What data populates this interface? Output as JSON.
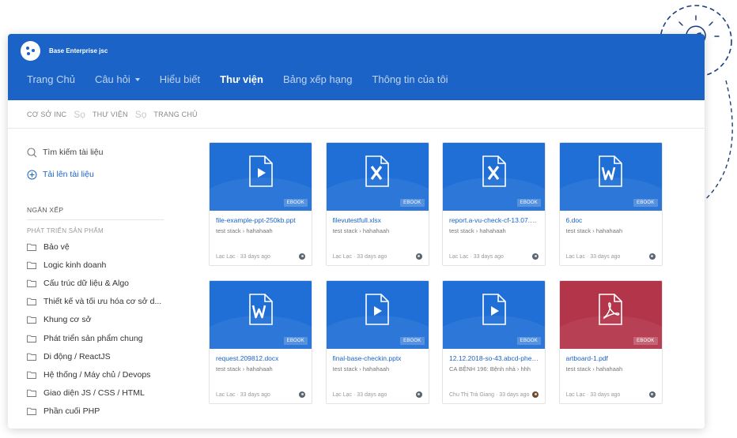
{
  "brand": {
    "name": "Base Enterprise jsc"
  },
  "nav": [
    {
      "label": "Trang Chủ",
      "active": false
    },
    {
      "label": "Câu hỏi",
      "active": false,
      "dropdown": true
    },
    {
      "label": "Hiểu biết",
      "active": false
    },
    {
      "label": "Thư viện",
      "active": true
    },
    {
      "label": "Bảng xếp hạng",
      "active": false
    },
    {
      "label": "Thông tin của tôi",
      "active": false
    }
  ],
  "breadcrumb": {
    "items": [
      "CƠ SỞ INC",
      "THƯ VIỆN",
      "TRANG CHỦ"
    ],
    "separator": "Sọ"
  },
  "sidebar": {
    "search_label": "Tìm kiếm tài liệu",
    "upload_label": "Tải lên tài liệu",
    "section_title": "NGĂN XẾP",
    "subsection_title": "PHÁT TRIỂN SẢN PHẨM",
    "categories": [
      "Bảo vệ",
      "Logic kinh doanh",
      "Cấu trúc dữ liệu & Algo",
      "Thiết kế và tối ưu hóa cơ sở d...",
      "Khung cơ sở",
      "Phát triển sản phẩm chung",
      "Di động / ReactJS",
      "Hệ thống / Máy chủ / Devops",
      "Giao diện JS / CSS / HTML",
      "Phần cuối PHP"
    ]
  },
  "files": [
    {
      "name": "file-example-ppt-250kb.ppt",
      "path": "test stack › hahahaah",
      "meta": "Lạc Lạc · 33 days ago",
      "badge": "EBOOK",
      "icon": "video-file-icon",
      "color": "blue"
    },
    {
      "name": "filevutestfull.xlsx",
      "path": "test stack › hahahaah",
      "meta": "Lạc Lạc · 33 days ago",
      "badge": "EBOOK",
      "icon": "excel-file-icon",
      "color": "blue"
    },
    {
      "name": "report.a-vu-check-cf-13.07.2...",
      "path": "test stack › hahahaah",
      "meta": "Lạc Lạc · 33 days ago",
      "badge": "EBOOK",
      "icon": "excel-file-icon",
      "color": "blue"
    },
    {
      "name": "6.doc",
      "path": "test stack › hahahaah",
      "meta": "Lạc Lạc · 33 days ago",
      "badge": "EBOOK",
      "icon": "word-file-icon",
      "color": "blue"
    },
    {
      "name": "request.209812.docx",
      "path": "test stack › hahahaah",
      "meta": "Lạc Lạc · 33 days ago",
      "badge": "EBOOK",
      "icon": "word-file-icon",
      "color": "blue"
    },
    {
      "name": "final-base-checkin.pptx",
      "path": "test stack › hahahaah",
      "meta": "Lạc Lạc · 33 days ago",
      "badge": "EBOOK",
      "icon": "video-file-icon",
      "color": "blue"
    },
    {
      "name": "12.12.2018-so-43.abcd-phe-...",
      "path": "CA BỆNH 196: Bệnh nhà › hhh",
      "meta": "Chu Thị Trà Giang · 33 days ago",
      "badge": "EBOOK",
      "icon": "video-file-icon",
      "color": "blue"
    },
    {
      "name": "artboard-1.pdf",
      "path": "test stack › hahahaah",
      "meta": "Lạc Lạc · 33 days ago",
      "badge": "EBOOK",
      "icon": "pdf-file-icon",
      "color": "red"
    }
  ],
  "colors": {
    "primary": "#1b63c6",
    "thumb_blue": "#1f6fd6",
    "thumb_red": "#b3354a"
  }
}
